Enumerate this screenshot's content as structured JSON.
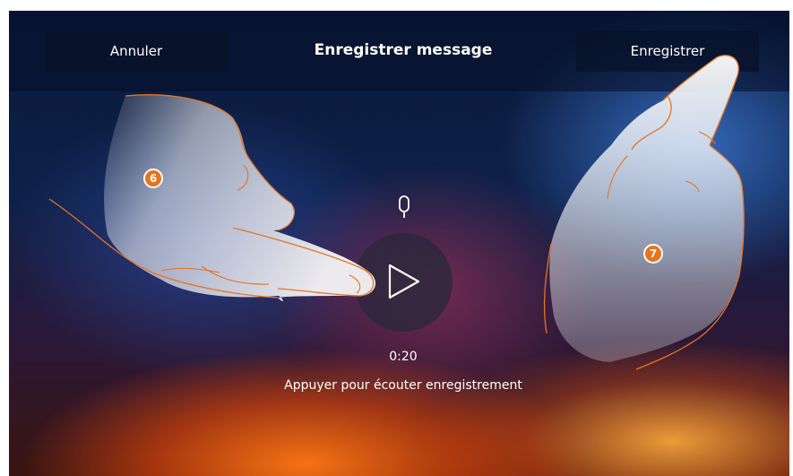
{
  "header": {
    "cancel_label": "Annuler",
    "title": "Enregistrer message",
    "save_label": "Enregistrer"
  },
  "player": {
    "mic_icon": "microphone-icon",
    "play_icon": "play-icon",
    "time": "0:20",
    "hint": "Appuyer pour écouter enregistrement"
  },
  "annotations": {
    "step_left": "6",
    "step_right": "7"
  },
  "colors": {
    "badge": "#e8731d",
    "hand_outline": "#e8731d"
  }
}
